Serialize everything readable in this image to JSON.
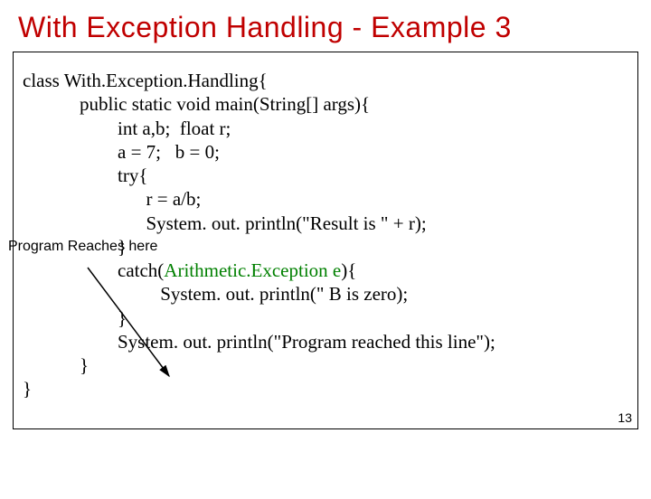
{
  "title": "With Exception Handling  - Example 3",
  "label": "Program Reaches here",
  "code": {
    "l1": "class With.Exception.Handling{",
    "l2": "            public static void main(String[] args){",
    "l3": "                    int a,b;  float r;",
    "l4": "                    a = 7;   b = 0;",
    "l5": "                    try{",
    "l6": "                          r = a/b;",
    "l7": "                          System. out. println(\"Result is \" + r);",
    "l8": "                    }",
    "l9a": "                    catch(",
    "l9b": "Arithmetic.Exception e",
    "l9c": "){",
    "l10": "                             System. out. println(\" B is zero);",
    "l11": "                    }",
    "l12": "                    System. out. println(\"Program reached this line\");",
    "l13": "            }",
    "l14": "}"
  },
  "pagenum": "13"
}
